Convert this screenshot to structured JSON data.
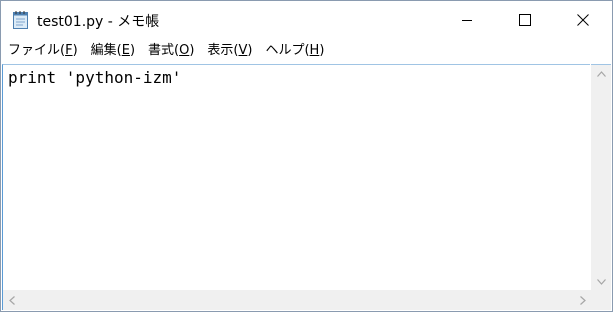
{
  "window": {
    "title": "test01.py - メモ帳",
    "app_icon": "notepad-icon"
  },
  "controls": {
    "minimize_icon": "minimize-icon",
    "maximize_icon": "maximize-icon",
    "close_icon": "close-icon"
  },
  "menu": {
    "items": [
      {
        "label": "ファイル(",
        "key": "F",
        "suffix": ")"
      },
      {
        "label": "編集(",
        "key": "E",
        "suffix": ")"
      },
      {
        "label": "書式(",
        "key": "O",
        "suffix": ")"
      },
      {
        "label": "表示(",
        "key": "V",
        "suffix": ")"
      },
      {
        "label": "ヘルプ(",
        "key": "H",
        "suffix": ")"
      }
    ]
  },
  "editor": {
    "content": "print 'python-izm'"
  },
  "scrollbars": {
    "up_icon": "chevron-up-icon",
    "down_icon": "chevron-down-icon",
    "left_icon": "chevron-left-icon",
    "right_icon": "chevron-right-icon"
  },
  "colors": {
    "accent_border": "#5b9bd5",
    "scrollbar_bg": "#f0f0f0"
  }
}
